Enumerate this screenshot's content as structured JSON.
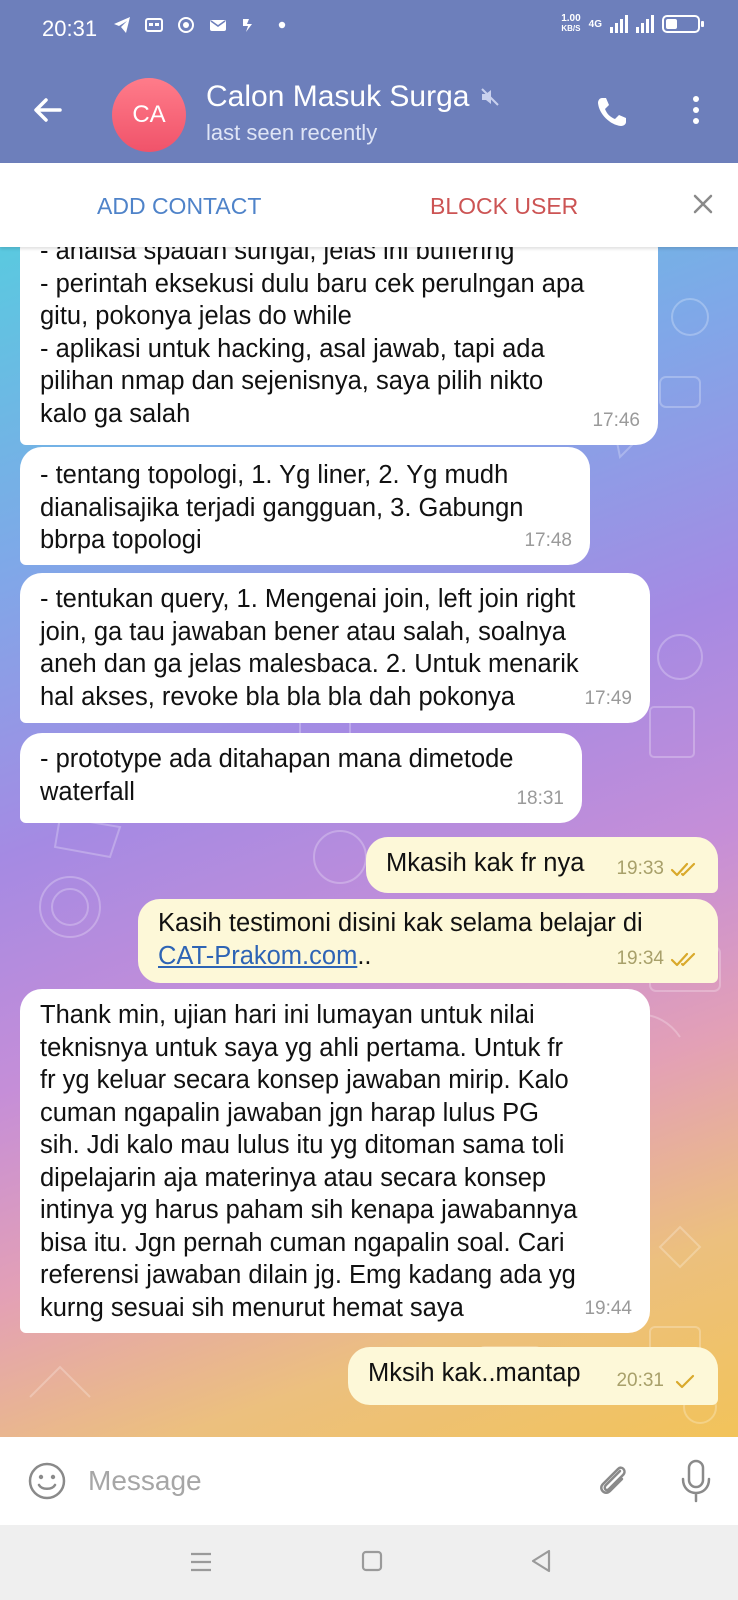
{
  "status_bar": {
    "time": "20:31",
    "net_speed_value": "1.00",
    "net_speed_unit": "KB/S",
    "net_type": "4G",
    "icons": [
      "telegram-icon",
      "message-icon",
      "app-icon",
      "mail-icon",
      "messenger-icon",
      "dot-icon",
      "signal-icon",
      "battery-icon"
    ]
  },
  "header": {
    "avatar_initials": "CA",
    "avatar_color": "#f26478",
    "title": "Calon Masuk Surga",
    "status": "last seen recently",
    "background": "#6d7fbb"
  },
  "action_bar": {
    "add_contact": "ADD CONTACT",
    "block_user": "BLOCK USER"
  },
  "messages": [
    {
      "direction": "in",
      "text": "- analisa spadan sungai, jelas ini buffering\n- perintah eksekusi dulu baru cek perulngan apa\ngitu, pokonya jelas do while\n- aplikasi untuk hacking, asal jawab, tapi ada\npilihan nmap dan sejenisnya, saya pilih nikto\nkalo ga salah",
      "time": "17:46"
    },
    {
      "direction": "in",
      "text": "- tentang topologi, 1. Yg liner, 2. Yg mudh\ndianalisajika terjadi gangguan, 3. Gabungn\nbbrpa topologi",
      "time": "17:48"
    },
    {
      "direction": "in",
      "text": "- tentukan query, 1. Mengenai join, left join right\njoin, ga tau jawaban bener atau salah, soalnya\naneh dan ga jelas malesbaca. 2. Untuk menarik\nhal akses, revoke bla bla bla dah pokonya",
      "time": "17:49"
    },
    {
      "direction": "in",
      "text": "- prototype ada ditahapan mana dimetode\nwaterfall",
      "time": "18:31"
    },
    {
      "direction": "out",
      "text": "Mkasih kak fr nya",
      "time": "19:33",
      "status": "read"
    },
    {
      "direction": "out",
      "text_before_link": "Kasih testimoni disini kak selama belajar di\n",
      "link": "CAT-Prakom.com",
      "text_after_link": "..",
      "time": "19:34",
      "status": "read"
    },
    {
      "direction": "in",
      "text": "Thank min, ujian hari ini lumayan untuk nilai\nteknisnya untuk saya yg ahli pertama. Untuk fr\nfr yg keluar secara konsep jawaban mirip. Kalo\ncuman ngapalin jawaban jgn harap lulus PG\nsih. Jdi kalo mau lulus itu yg ditoman sama toli\ndipelajarin aja materinya atau secara konsep\nintinya yg harus paham sih kenapa jawabannya\nbisa itu. Jgn pernah cuman ngapalin soal. Cari\nreferensi jawaban dilain jg. Emg kadang ada yg\nkurng sesuai sih menurut hemat saya",
      "time": "19:44"
    },
    {
      "direction": "out",
      "text": "Mksih kak..mantap",
      "time": "20:31",
      "status": "sent"
    }
  ],
  "composer": {
    "placeholder": "Message"
  },
  "colors": {
    "incoming_bubble": "#ffffff",
    "outgoing_bubble": "#fdf8d8",
    "tick_color": "#d9a92b",
    "accent_blue": "#4f83c9",
    "accent_red": "#cc5454"
  }
}
